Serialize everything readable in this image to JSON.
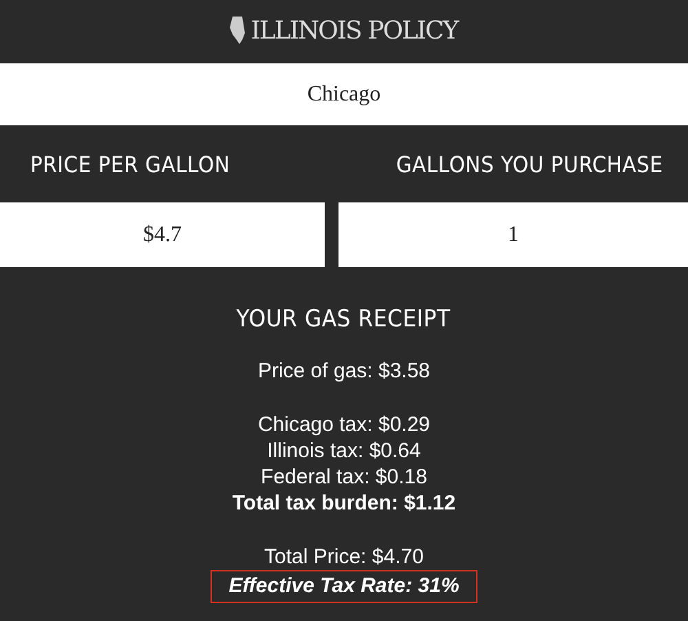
{
  "header": {
    "logo_text": "ILLINOIS POLICY"
  },
  "city_field": {
    "value": "Chicago"
  },
  "fields": [
    {
      "label": "PRICE PER GALLON",
      "value": "$4.7"
    },
    {
      "label": "GALLONS YOU PURCHASE",
      "value": "1"
    }
  ],
  "receipt": {
    "title": "YOUR GAS RECEIPT",
    "groups": [
      [
        {
          "text": "Price of gas: $3.58",
          "kind": "plain"
        }
      ],
      [
        {
          "text": "Chicago tax: $0.29",
          "kind": "plain"
        },
        {
          "text": "Illinois tax: $0.64",
          "kind": "plain"
        },
        {
          "text": "Federal tax: $0.18",
          "kind": "plain"
        },
        {
          "text": "Total tax burden: $1.12",
          "kind": "total"
        }
      ],
      [
        {
          "text": "Total Price: $4.70",
          "kind": "plain"
        },
        {
          "text": "Effective Tax Rate: 31%",
          "kind": "highlight"
        }
      ]
    ]
  }
}
